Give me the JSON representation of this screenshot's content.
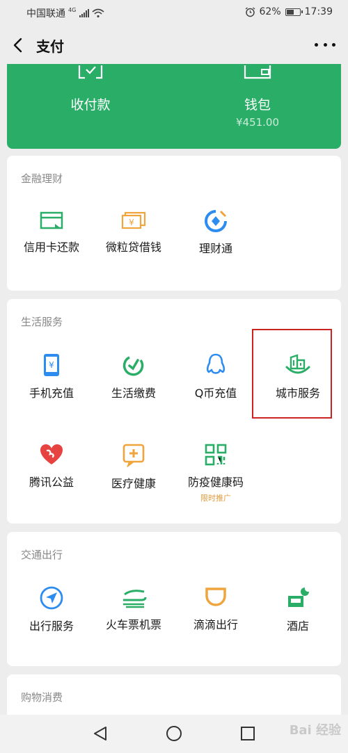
{
  "status_bar": {
    "carrier": "中国联通",
    "network": "4G",
    "battery": "62%",
    "battery_level": 0.62,
    "time": "17:39"
  },
  "nav": {
    "title": "支付",
    "back_icon": "back-chevron-icon",
    "more_icon": "more-dots-icon"
  },
  "header": {
    "pay": {
      "label": "收付款",
      "icon": "qr-scan-icon"
    },
    "wallet": {
      "label": "钱包",
      "balance": "¥451.00",
      "icon": "wallet-icon"
    },
    "color": "#2aae67"
  },
  "finance": {
    "title": "金融理财",
    "items": [
      {
        "label": "信用卡还款",
        "icon": "credit-card-icon",
        "color": "#2aae67"
      },
      {
        "label": "微粒贷借钱",
        "icon": "yuan-bills-icon",
        "color": "#f0a43c"
      },
      {
        "label": "理财通",
        "icon": "wealth-icon",
        "color": "#2d8cf0"
      }
    ]
  },
  "life": {
    "title": "生活服务",
    "items": [
      {
        "label": "手机充值",
        "icon": "phone-topup-icon",
        "color": "#2d8cf0"
      },
      {
        "label": "生活缴费",
        "icon": "utility-bill-icon",
        "color": "#2aae67"
      },
      {
        "label": "Q币充值",
        "icon": "qq-penguin-icon",
        "color": "#2d8cf0"
      },
      {
        "label": "城市服务",
        "icon": "city-building-icon",
        "color": "#2aae67"
      },
      {
        "label": "腾讯公益",
        "icon": "charity-heart-icon",
        "color": "#e64340"
      },
      {
        "label": "医疗健康",
        "icon": "medical-plus-icon",
        "color": "#f0a43c"
      },
      {
        "label": "防疫健康码",
        "icon": "health-qr-icon",
        "color": "#2aae67",
        "tag": "限时推广"
      }
    ]
  },
  "transport": {
    "title": "交通出行",
    "items": [
      {
        "label": "出行服务",
        "icon": "navigation-arrow-icon",
        "color": "#2d8cf0"
      },
      {
        "label": "火车票机票",
        "icon": "train-plane-icon",
        "color": "#2aae67"
      },
      {
        "label": "滴滴出行",
        "icon": "didi-icon",
        "color": "#f0a43c"
      },
      {
        "label": "酒店",
        "icon": "hotel-bed-icon",
        "color": "#2aae67"
      }
    ]
  },
  "shopping": {
    "title": "购物消费"
  },
  "watermark": "Bai 经验"
}
